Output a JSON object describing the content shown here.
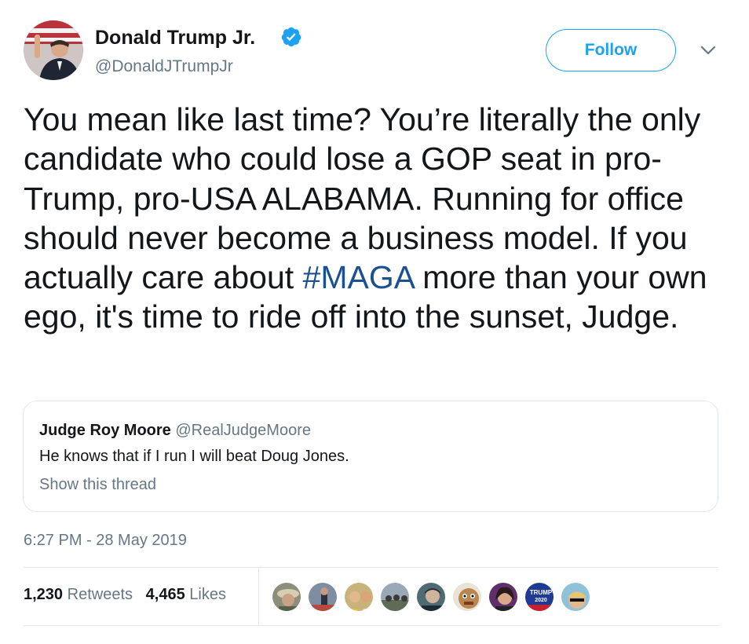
{
  "author": {
    "name": "Donald Trump Jr.",
    "handle": "@DonaldJTrumpJr",
    "verified_icon": "verified-badge-icon"
  },
  "actions": {
    "follow_label": "Follow",
    "menu_icon": "chevron-down-icon"
  },
  "tweet": {
    "text_before_hashtag": "You mean like last time? You’re literally the only candidate who could lose a GOP seat in pro-Trump, pro-USA ALABAMA. Running for office should never become a business model. If you actually care about ",
    "hashtag": "#MAGA",
    "text_after_hashtag": " more than your own ego, it's time to ride off into the sunset, Judge."
  },
  "quoted_tweet": {
    "author_name": "Judge Roy Moore",
    "author_handle": "@RealJudgeMoore",
    "text": "He knows that if I run I will beat Doug Jones.",
    "show_thread_label": "Show this thread"
  },
  "timestamp": "6:27 PM - 28 May 2019",
  "stats": {
    "retweets_count": "1,230",
    "retweets_label": "Retweets",
    "likes_count": "4,465",
    "likes_label": "Likes"
  },
  "liker_avatars": [
    {
      "name": "liker-avatar"
    },
    {
      "name": "liker-avatar"
    },
    {
      "name": "liker-avatar"
    },
    {
      "name": "liker-avatar"
    },
    {
      "name": "liker-avatar"
    },
    {
      "name": "liker-avatar"
    },
    {
      "name": "liker-avatar"
    },
    {
      "name": "liker-avatar"
    },
    {
      "name": "liker-avatar"
    }
  ],
  "colors": {
    "accent": "#1da1f2",
    "hashtag": "#1b5192",
    "secondary_text": "#657786",
    "border": "#e1e8ed"
  }
}
